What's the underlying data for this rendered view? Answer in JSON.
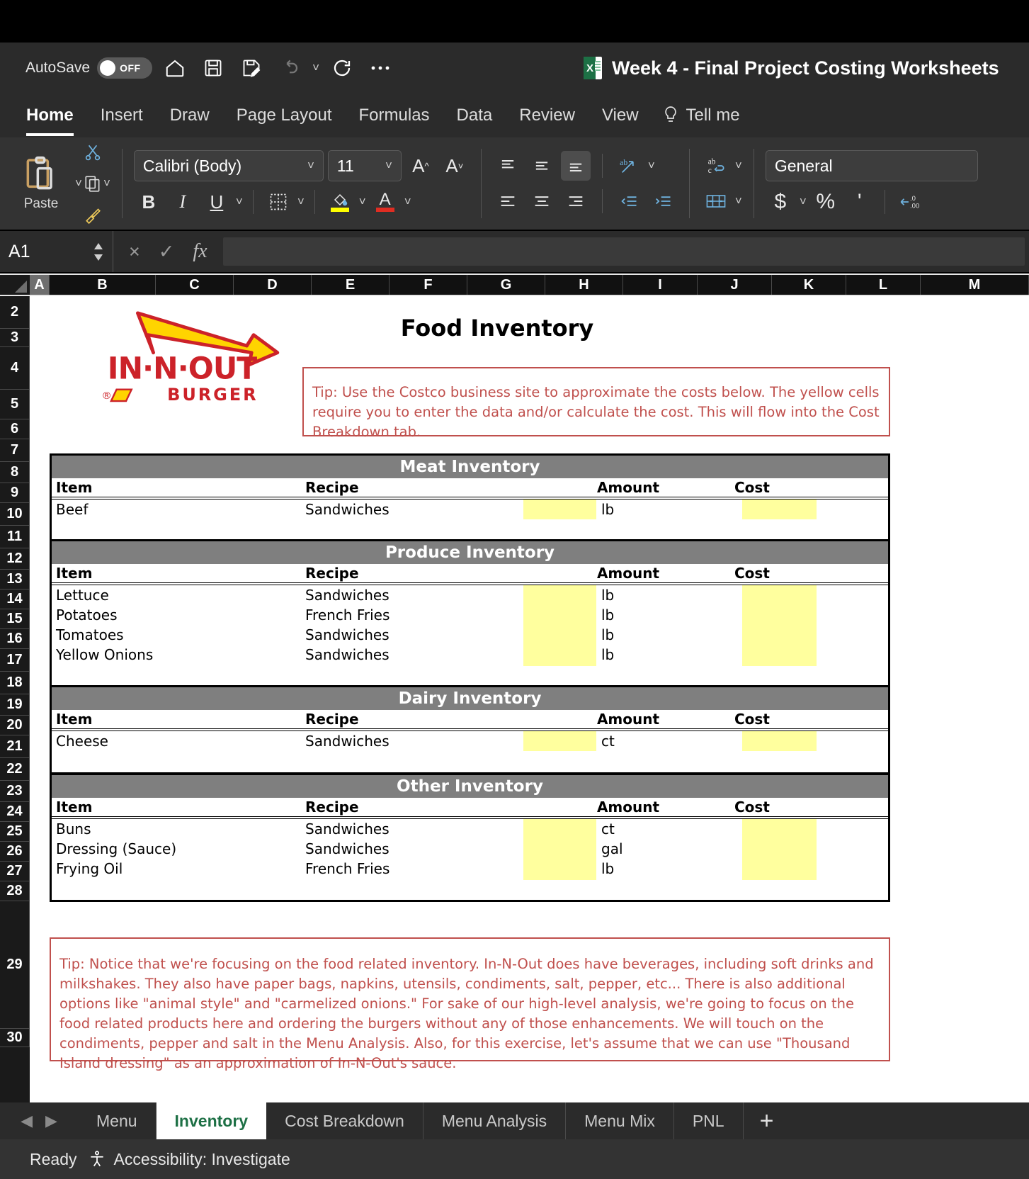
{
  "titlebar": {
    "autosave_label": "AutoSave",
    "autosave_state": "OFF",
    "document_title": "Week 4 - Final Project Costing Worksheets",
    "icons": [
      "home-icon",
      "save-icon",
      "save-as-icon",
      "undo-icon",
      "redo-icon",
      "more-icon"
    ]
  },
  "ribbon_tabs": [
    {
      "label": "Home",
      "active": true
    },
    {
      "label": "Insert",
      "active": false
    },
    {
      "label": "Draw",
      "active": false
    },
    {
      "label": "Page Layout",
      "active": false
    },
    {
      "label": "Formulas",
      "active": false
    },
    {
      "label": "Data",
      "active": false
    },
    {
      "label": "Review",
      "active": false
    },
    {
      "label": "View",
      "active": false
    }
  ],
  "tell_me": "Tell me",
  "ribbon": {
    "paste_label": "Paste",
    "font_name": "Calibri (Body)",
    "font_size": "11",
    "grow_font": "A",
    "shrink_font": "A",
    "bold": "B",
    "italic": "I",
    "underline": "U",
    "number_format": "General",
    "currency": "$",
    "percent": "%",
    "comma": "'"
  },
  "formula_bar": {
    "name_box": "A1",
    "formula_value": "",
    "cancel_icon": "×",
    "enter_icon": "✓",
    "fx_icon": "fx"
  },
  "grid": {
    "columns": [
      "A",
      "B",
      "C",
      "D",
      "E",
      "F",
      "G",
      "H",
      "I",
      "J",
      "K",
      "L",
      "M"
    ],
    "selected_column": "A",
    "rows": [
      "2",
      "3",
      "4",
      "5",
      "6",
      "7",
      "8",
      "9",
      "10",
      "11",
      "12",
      "13",
      "14",
      "15",
      "16",
      "17",
      "18",
      "19",
      "20",
      "21",
      "22",
      "23",
      "24",
      "25",
      "26",
      "27",
      "28",
      "29",
      "30"
    ]
  },
  "sheet": {
    "logo_text_main": "IN·N·OUT",
    "logo_text_sub": "BURGER",
    "logo_reg": "®",
    "title": "Food Inventory",
    "tip_top": "Tip:  Use the Costco business site to approximate the costs below.  The yellow cells require you to enter the data and/or calculate the cost.  This will flow into the Cost Breakdown tab.",
    "tip_bottom": "Tip:  Notice that we're focusing on the food related inventory.  In-N-Out does have beverages, including soft drinks and milkshakes.  They also have paper bags, napkins, utensils, condiments, salt, pepper, etc...  There is also additional options like \"animal style\" and \"carmelized onions.\"  For sake of our high-level analysis, we're going to focus on the food related products here and ordering the burgers without any of those enhancements.  We will touch on the condiments, pepper and salt in the Menu Analysis.  Also, for this exercise, let's assume that we can use \"Thousand Island dressing\" as an approximation of In-N-Out's sauce.",
    "column_headers": {
      "item": "Item",
      "recipe": "Recipe",
      "amount": "Amount",
      "cost": "Cost"
    },
    "tables": [
      {
        "band": "Meat Inventory",
        "rows": [
          {
            "item": "Beef",
            "recipe": "Sandwiches",
            "unit": "lb",
            "amount": "",
            "cost": ""
          }
        ]
      },
      {
        "band": "Produce Inventory",
        "rows": [
          {
            "item": "Lettuce",
            "recipe": "Sandwiches",
            "unit": "lb",
            "amount": "",
            "cost": ""
          },
          {
            "item": "Potatoes",
            "recipe": "French Fries",
            "unit": "lb",
            "amount": "",
            "cost": ""
          },
          {
            "item": "Tomatoes",
            "recipe": "Sandwiches",
            "unit": "lb",
            "amount": "",
            "cost": ""
          },
          {
            "item": "Yellow Onions",
            "recipe": "Sandwiches",
            "unit": "lb",
            "amount": "",
            "cost": ""
          }
        ]
      },
      {
        "band": "Dairy Inventory",
        "rows": [
          {
            "item": "Cheese",
            "recipe": "Sandwiches",
            "unit": "ct",
            "amount": "",
            "cost": ""
          }
        ]
      },
      {
        "band": "Other Inventory",
        "rows": [
          {
            "item": "Buns",
            "recipe": "Sandwiches",
            "unit": "ct",
            "amount": "",
            "cost": ""
          },
          {
            "item": "Dressing (Sauce)",
            "recipe": "Sandwiches",
            "unit": "gal",
            "amount": "",
            "cost": ""
          },
          {
            "item": "Frying Oil",
            "recipe": "French Fries",
            "unit": "lb",
            "amount": "",
            "cost": ""
          }
        ]
      }
    ]
  },
  "sheet_tabs": [
    {
      "label": "Menu",
      "active": false
    },
    {
      "label": "Inventory",
      "active": true
    },
    {
      "label": "Cost Breakdown",
      "active": false
    },
    {
      "label": "Menu Analysis",
      "active": false
    },
    {
      "label": "Menu Mix",
      "active": false
    },
    {
      "label": "PNL",
      "active": false
    }
  ],
  "add_sheet": "+",
  "statusbar": {
    "state": "Ready",
    "accessibility": "Accessibility: Investigate"
  },
  "colors": {
    "band": "#7f7f7f",
    "tip_red": "#c0504d",
    "yellow_cell": "#ffff9e",
    "excel_green": "#1d7045",
    "logo_red": "#cc2229",
    "logo_yellow": "#ffd400"
  }
}
